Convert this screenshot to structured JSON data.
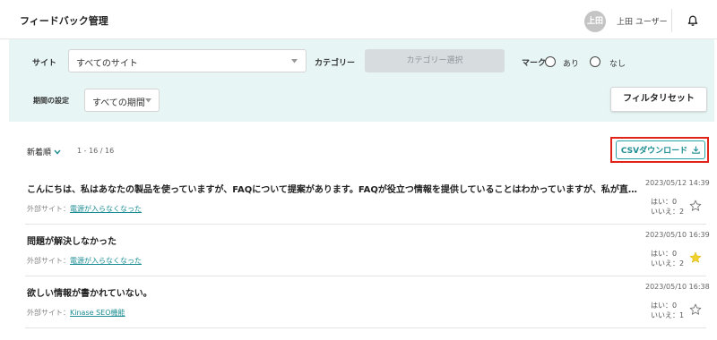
{
  "header": {
    "title": "フィードバック管理",
    "avatar_text": "上田",
    "user_name": "上田 ユーザー"
  },
  "filters": {
    "site_label": "サイト",
    "site_value": "すべてのサイト",
    "category_label": "カテゴリー",
    "category_button": "カテゴリー選択",
    "mark_label": "マーク",
    "mark_options": [
      "あり",
      "なし"
    ],
    "period_label": "期間の設定",
    "period_value": "すべての期間",
    "reset_button": "フィルタリセット"
  },
  "list": {
    "sort_label": "新着順",
    "count_text": "1 - 16 / 16",
    "csv_button": "CSVダウンロード"
  },
  "feedback": [
    {
      "title": "こんにちは、私はあなたの製品を使っていますが、FAQについて提案があります。FAQが役立つ情報を提供していることはわかっていますが、私が直面してい...",
      "site_prefix": "外部サイト：",
      "site_link": "電源が入らなくなった",
      "date": "2023/05/12 14:39",
      "yes": "はい：0",
      "no": "いいえ：2",
      "starred": false
    },
    {
      "title": "問題が解決しなかった",
      "site_prefix": "外部サイト：",
      "site_link": "電源が入らなくなった",
      "date": "2023/05/10 16:39",
      "yes": "はい：0",
      "no": "いいえ：2",
      "starred": true
    },
    {
      "title": "欲しい情報が書かれていない。",
      "site_prefix": "外部サイト：",
      "site_link": "Kinase SEO機能",
      "date": "2023/05/10 16:38",
      "yes": "はい：0",
      "no": "いいえ：1",
      "starred": false
    }
  ],
  "colors": {
    "accent": "#1c8d93",
    "filter_bg": "#e7f5f5",
    "highlight": "#e2231a",
    "star_on": "#f2d230"
  }
}
